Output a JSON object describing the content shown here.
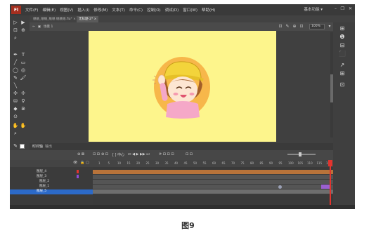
{
  "menubar": {
    "logo": "Fl",
    "items": [
      "文件(F)",
      "编辑(E)",
      "视图(V)",
      "插入(I)",
      "修改(M)",
      "文本(T)",
      "命令(C)",
      "控制(O)",
      "调试(D)",
      "窗口(W)",
      "帮助(H)"
    ],
    "workspace": "基本功能 ▾",
    "minimize": "–",
    "maximize": "❐",
    "close": "✕"
  },
  "tabs": [
    {
      "label": "纸纸_纸纸_纸纸 纸纸纸.fla* ×",
      "active": false
    },
    {
      "label": "无标题-2* ×",
      "active": true
    }
  ],
  "editbar": {
    "back": "⇦",
    "scene_icon": "▣",
    "scene": "场景 1",
    "zoom": "100%"
  },
  "stage": {
    "background": "#fdf58c",
    "character_circle": "#f7b74a"
  },
  "timeline": {
    "tabs": [
      "时间轴",
      "输出"
    ],
    "toolbar": [
      "⊕ ⊠",
      "⊡ ⊟",
      "⊕ ⊡",
      "[ ] 中心",
      "⏮ ◀ ▶ ▶▶ ⏭",
      "⟳ ⊡ ⊡ ⊡",
      "⊡ ⊡"
    ],
    "ruler": [
      "1",
      "5",
      "10",
      "15",
      "20",
      "25",
      "30",
      "35",
      "40",
      "45",
      "50",
      "55",
      "60",
      "65",
      "70",
      "75",
      "80",
      "85",
      "90",
      "95",
      "100",
      "105",
      "110",
      "115",
      "120"
    ],
    "layers": [
      {
        "name": "图层_4",
        "selected": false
      },
      {
        "name": "图层_3",
        "selected": false
      },
      {
        "name": "图层_2",
        "selected": false
      },
      {
        "name": "图层_1",
        "selected": false
      },
      {
        "name": "图层_5",
        "selected": true
      }
    ]
  },
  "caption": "图9"
}
